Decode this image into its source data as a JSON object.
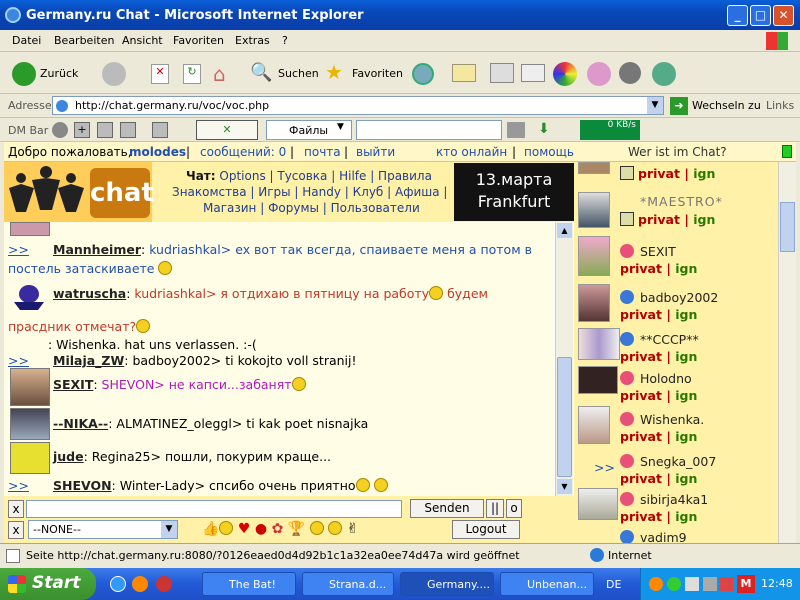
{
  "window": {
    "title": "Germany.ru Chat - Microsoft Internet Explorer"
  },
  "menu": [
    "Datei",
    "Bearbeiten",
    "Ansicht",
    "Favoriten",
    "Extras",
    "?"
  ],
  "toolbar": {
    "back": "Zurück",
    "search": "Suchen",
    "favorites": "Favoriten"
  },
  "address": {
    "label": "Adresse",
    "url": "http://chat.germany.ru/voc/voc.php",
    "go": "Wechseln zu",
    "links": "Links"
  },
  "dmbar": {
    "label": "DM Bar",
    "files": "Файлы",
    "speed": "0 KB/s"
  },
  "topline": {
    "welcome": "Добро пожаловать,",
    "user": "molodes",
    "messages": "сообщений: 0",
    "mail": "почта",
    "logout": "выйти",
    "online": "кто онлайн",
    "help": "помощь",
    "whois": "Wer ist im Chat?"
  },
  "logo": {
    "text": "chat"
  },
  "nav": {
    "line1_label": "Чат:",
    "line1": "Options | Тусовка | Hilfe | Правила",
    "line2": "Знакомства | Игры | Handy | Клуб | Афиша |",
    "line3": "Магазин | Форумы | Пользователи"
  },
  "banner": {
    "line1": "13.марта",
    "line2": "Frankfurt"
  },
  "messages": [
    {
      "prefix": ">>",
      "nick": "Mannheimer",
      "text": "kudriashkal> ex вот так всегда, спаиваете меня а потом в",
      "cont": "постель затаскиваете"
    },
    {
      "nick": "watruscha",
      "text": "kudriashkal> я отдихаю в пятницу на работу",
      "text2": "будем",
      "cont": "прасдник отмечат?"
    },
    {
      "text": ": Wishenka. hat uns verlassen. :-("
    },
    {
      "prefix": ">>",
      "nick": "Milaja_ZW",
      "text": "badboy2002> ti kokojto voll stranij!"
    },
    {
      "nick": "SEXIT",
      "text": "SHEVON> не капси...забанят"
    },
    {
      "nick": "--NIKA--",
      "text": "ALMATINEZ_oleggl> ti kak poet nisnajka"
    },
    {
      "nick": "jude",
      "text": "Regina25> пошли, покурим краще..."
    },
    {
      "prefix": ">>",
      "nick": "SHEVON",
      "text": "Winter-Lady> спсибо очень приятно"
    }
  ],
  "users": [
    {
      "name": "",
      "privat": "privat",
      "ign": "ign"
    },
    {
      "name": "*MAESTRO*",
      "privat": "privat",
      "ign": "ign"
    },
    {
      "name": "SEXIT",
      "privat": "privat",
      "ign": "ign"
    },
    {
      "name": "badboy2002",
      "privat": "privat",
      "ign": "ign"
    },
    {
      "name": "**CCCP**",
      "privat": "privat",
      "ign": "ign"
    },
    {
      "name": "Holodno",
      "privat": "privat",
      "ign": "ign"
    },
    {
      "name": "Wishenka.",
      "privat": "privat",
      "ign": "ign"
    },
    {
      "name": "Snegka_007",
      "privat": "privat",
      "ign": "ign",
      "prefix": ">>"
    },
    {
      "name": "sibirja4ka1",
      "privat": "privat",
      "ign": "ign"
    },
    {
      "name": "vadim9"
    }
  ],
  "input": {
    "x": "x",
    "send": "Senden",
    "pause": "||",
    "o": "o",
    "select": "--NONE--",
    "logout": "Logout"
  },
  "status": {
    "text": "Seite http://chat.germany.ru:8080/?0126eaed0d4d92b1c1a32ea0ee74d47a wird geöffnet",
    "zone": "Internet"
  },
  "taskbar": {
    "start": "Start",
    "tasks": [
      "The Bat!",
      "Strana.d...",
      "Germany....",
      "Unbenan..."
    ],
    "lang": "DE",
    "time": "12:48"
  }
}
